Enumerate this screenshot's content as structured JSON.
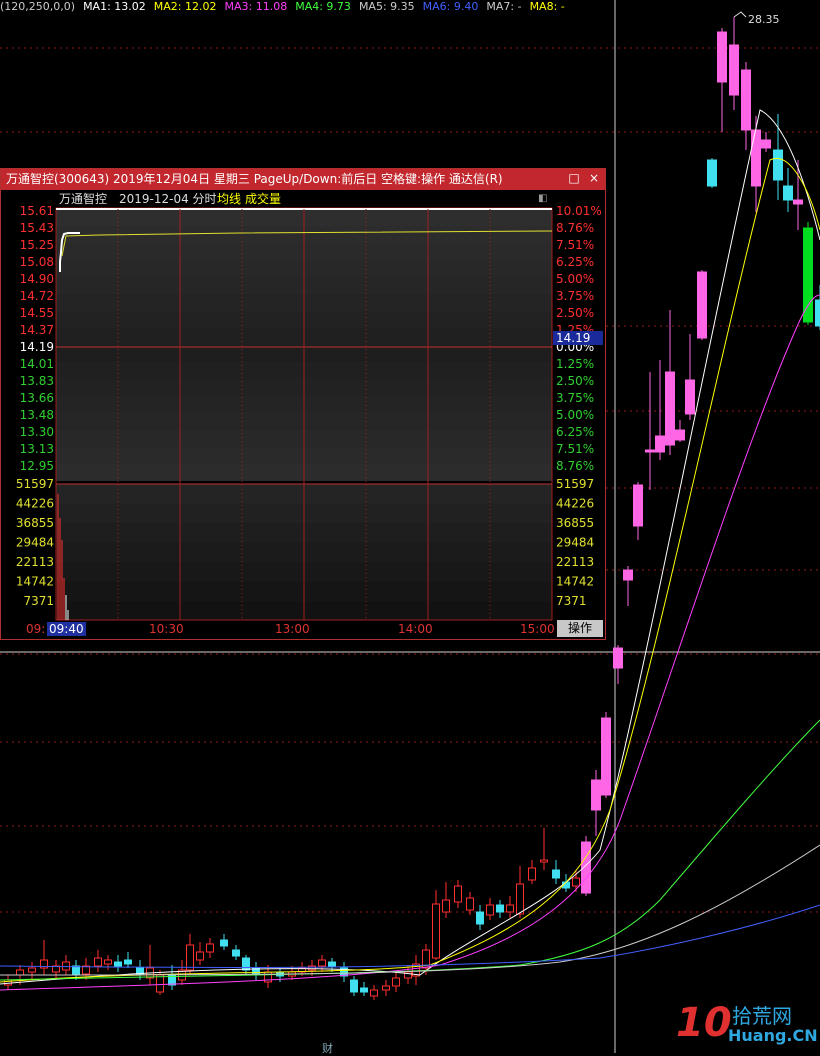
{
  "ma_bar": {
    "items": [
      {
        "text": "(120,250,0,0)",
        "color": "#cccccc"
      },
      {
        "text": "MA1: 13.02",
        "color": "#ffffff"
      },
      {
        "text": "MA2: 12.02",
        "color": "#ffff00"
      },
      {
        "text": "MA3: 11.08",
        "color": "#ff40ff"
      },
      {
        "text": "MA4: 9.73",
        "color": "#40ff40"
      },
      {
        "text": "MA5: 9.35",
        "color": "#cccccc"
      },
      {
        "text": "MA6: 9.40",
        "color": "#4060ff"
      },
      {
        "text": "MA7: -",
        "color": "#cccccc"
      },
      {
        "text": "MA8: -",
        "color": "#ffff00"
      }
    ]
  },
  "peak_label": "28.35",
  "bottom_mark": "财",
  "watermark": {
    "num": "10",
    "cn": "拾荒网",
    "en": "Huang.CN"
  },
  "popup": {
    "title": "万通智控(300643) 2019年12月04日 星期三 PageUp/Down:前后日 空格键:操作 通达信(R)",
    "restore_icon": "□",
    "close_icon": "×",
    "sub_name": "万通智控",
    "sub_date": "2019-12-04 分时",
    "sub_avg": "均线",
    "sub_vol": "成交量",
    "current_price": "14.19",
    "time_start": "09:",
    "time_cursor": "09:40",
    "times": [
      "10:30",
      "13:00",
      "14:00",
      "15:00"
    ],
    "op_label": "操作",
    "price_labels": [
      "15.61",
      "15.43",
      "15.25",
      "15.08",
      "14.90",
      "14.72",
      "14.55",
      "14.37",
      "14.19",
      "14.01",
      "13.83",
      "13.66",
      "13.48",
      "13.30",
      "13.13",
      "12.95"
    ],
    "pct_labels": [
      "10.01%",
      "8.76%",
      "7.51%",
      "6.25%",
      "5.00%",
      "3.75%",
      "2.50%",
      "1.25%",
      "0.00%",
      "1.25%",
      "2.50%",
      "3.75%",
      "5.00%",
      "6.25%",
      "7.51%",
      "8.76%"
    ],
    "vol_labels": [
      "51597",
      "44226",
      "36855",
      "29484",
      "22113",
      "14742",
      "7371"
    ],
    "colors": {
      "up": "#ff3030",
      "down": "#30d030",
      "flat": "#ffffff",
      "vol": "#e0e030",
      "title_bg": "#c1272d"
    }
  }
}
